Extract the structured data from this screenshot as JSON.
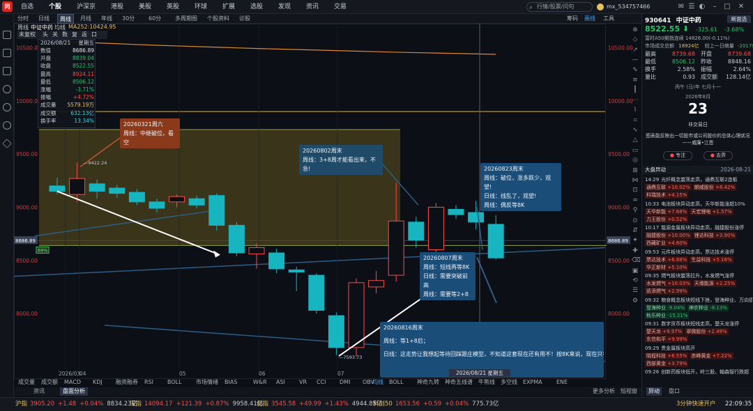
{
  "app": {
    "logo": "自选",
    "menus": [
      "自选",
      "个股",
      "沪深京",
      "港股",
      "美股",
      "英股",
      "环球",
      "扩展",
      "选股",
      "发现",
      "资讯",
      "交易"
    ],
    "active_menu": "个股",
    "search_placeholder": "行情/股票/问句",
    "user": "mx_534757466"
  },
  "tabbar": {
    "tabs": [
      "分时",
      "日线",
      "周线",
      "月线",
      "年线",
      "30分",
      "60分",
      "多周期图",
      "个股资料",
      "诊股"
    ],
    "selected": "周线",
    "right_items": [
      "筹码",
      "画线",
      "工具"
    ]
  },
  "indicator_row": {
    "label1": "周线",
    "label2": "中证中药",
    "label3": "均线",
    "ma": "MA252:10424.95"
  },
  "toolbar2": [
    "未复权",
    "头",
    "关",
    "数",
    "复",
    "返",
    "口"
  ],
  "info_panel": {
    "date": "2026/08/21",
    "weekday": "星期五",
    "rows": [
      {
        "k": "数值",
        "v": "8686.89",
        "c": "white"
      },
      {
        "k": "开盘",
        "v": "8839.04",
        "c": "green"
      },
      {
        "k": "收盘",
        "v": "8522.55",
        "c": "green"
      },
      {
        "k": "最高",
        "v": "8924.11",
        "c": "red"
      },
      {
        "k": "最低",
        "v": "8506.12",
        "c": "green"
      },
      {
        "k": "涨幅",
        "v": "-3.71%",
        "c": "green"
      },
      {
        "k": "振幅",
        "v": "+4.72%",
        "c": "red"
      },
      {
        "k": "成交量",
        "v": "5579.19万",
        "c": "yellow"
      },
      {
        "k": "成交额",
        "v": "632.13亿",
        "c": "cyan"
      },
      {
        "k": "换手率",
        "v": "13.34%",
        "c": "cyan"
      }
    ]
  },
  "notes": {
    "n1_title": "20260321周六",
    "n1_body": "周线：中继破位，看空",
    "n2_title": "20260802周末",
    "n2_body": "周线：3+8周才能看出来，不急!",
    "n3_title": "20260823周末",
    "n3_l1": "周线：破位，涨多跌少，观望!",
    "n3_l2": "日线：线乱了，观望!",
    "n3_l3": "周线：偶反等8K",
    "n4_title": "20260807周末",
    "n4_l1": "周线：短线再等8K",
    "n4_l2": "日线：需要突破前高",
    "n4_l3": "周线：需要等2+8",
    "n5_title": "20260816周末",
    "n5_l1": "周线：等1+8后；",
    "n5_l2": "日线：这走势让我想起等待回踩跟庄模型，不知道这套现在还有用不！按8K来说，现在只有"
  },
  "chart_data": {
    "type": "candlestick",
    "title": "中证中药",
    "period": "周线",
    "y_ticks": [
      "10500.00",
      "10000.00",
      "9500.00",
      "9000.00",
      "8500.00",
      "8000.00"
    ],
    "ylim": [
      7450,
      10700
    ],
    "x_ticks": [
      "2026/03",
      "04",
      "05",
      "06",
      "07"
    ],
    "current_price_label": "8686.89",
    "cursor_date": "2026/08/21 星期五",
    "percent_label": "69%",
    "high_label": "9422.24",
    "low_label": "7593.73",
    "candles": [
      {
        "o": 9200,
        "c": 9150,
        "h": 9280,
        "l": 9120
      },
      {
        "o": 9120,
        "c": 9270,
        "h": 9422,
        "l": 9050
      },
      {
        "o": 9220,
        "c": 9150,
        "h": 9260,
        "l": 9080
      },
      {
        "o": 9180,
        "c": 9130,
        "h": 9210,
        "l": 9090
      },
      {
        "o": 9140,
        "c": 9050,
        "h": 9170,
        "l": 9020
      },
      {
        "o": 9050,
        "c": 8990,
        "h": 9080,
        "l": 8950
      },
      {
        "o": 9050,
        "c": 9100,
        "h": 9120,
        "l": 9000
      },
      {
        "o": 9080,
        "c": 9020,
        "h": 9110,
        "l": 8990
      },
      {
        "o": 9110,
        "c": 8830,
        "h": 9130,
        "l": 8780
      },
      {
        "o": 8830,
        "c": 8570,
        "h": 8860,
        "l": 8540
      },
      {
        "o": 8560,
        "c": 8620,
        "h": 8660,
        "l": 8420
      },
      {
        "o": 8570,
        "c": 8420,
        "h": 8610,
        "l": 8380
      },
      {
        "o": 8410,
        "c": 8390,
        "h": 8440,
        "l": 8210
      },
      {
        "o": 8360,
        "c": 8030,
        "h": 8380,
        "l": 8000
      },
      {
        "o": 7980,
        "c": 7680,
        "h": 8010,
        "l": 7610
      },
      {
        "o": 7680,
        "c": 8290,
        "h": 8330,
        "l": 7594
      },
      {
        "o": 8250,
        "c": 8310,
        "h": 8400,
        "l": 8190
      },
      {
        "o": 8360,
        "c": 8870,
        "h": 9230,
        "l": 8300
      },
      {
        "o": 8860,
        "c": 8690,
        "h": 8910,
        "l": 8620
      },
      {
        "o": 8600,
        "c": 9000,
        "h": 9040,
        "l": 8560
      },
      {
        "o": 8980,
        "c": 8930,
        "h": 9020,
        "l": 8890
      },
      {
        "o": 8950,
        "c": 8860,
        "h": 9060,
        "l": 8790
      },
      {
        "o": 8839,
        "c": 8523,
        "h": 8924,
        "l": 8506
      }
    ],
    "ma_line": [
      10560,
      10552,
      10545,
      10538,
      10530,
      10523,
      10517,
      10511,
      10505,
      10499,
      10493,
      10488,
      10483,
      10478,
      10473,
      10468,
      10463,
      10458,
      10454,
      10450,
      10446,
      10442,
      10438
    ],
    "zone": {
      "top": 9730,
      "bottom": 8640
    },
    "hline": 9900
  },
  "indicator_tabs": [
    "成交量",
    "成交额",
    "MACD",
    "KDJ",
    "融资融券",
    "RSI",
    "BOLL",
    "市场情绪",
    "BIAS",
    "W&R",
    "ASI",
    "VR",
    "CCI",
    "DMI",
    "OBV"
  ],
  "sub_tabs": [
    "均线",
    "BOLL",
    "神奇九转",
    "神奇五线谱",
    "牛熊线",
    "多空线",
    "EXPMA",
    "ENE"
  ],
  "sub_bar": [
    "资讯",
    "盘面分析"
  ],
  "sub_right": [
    "更多分析",
    "短视窗"
  ],
  "right_panel": {
    "code": "930641",
    "name": "中证中药",
    "buttons": [
      "断面选"
    ],
    "price": "8522.55",
    "change": "-325.61",
    "pct": "-3.68%",
    "line1": "富时A50期指连续  14826.00(-0.11%)",
    "line2a": "市场成交总额",
    "line2b": "18924亿",
    "line2c": "较上一日缩量",
    "line2d": "-2017亿",
    "quotes": [
      {
        "k": "最高",
        "v": "8739.68",
        "k2": "开盘",
        "v2": "8739.68"
      },
      {
        "k": "最低",
        "v": "8506.12",
        "k2": "昨收",
        "v2": "8848.16"
      },
      {
        "k": "换手",
        "v": "2.58%",
        "k2": "振幅",
        "v2": "2.64%"
      },
      {
        "k": "量比",
        "v": "0.93",
        "k2": "成交额",
        "v2": "128.14亿"
      }
    ],
    "cal_lunar": "丙午 (马)年 七月十一",
    "cal_month": "2026年8月",
    "cal_day": "23",
    "cal_status": "非交易日",
    "quote_text": "图表能反映出一切股市或公司股价的总体心理状况",
    "quote_author": "——威廉•江恩",
    "btn_a": "专注",
    "btn_b": "去弄",
    "news_header": "大盘异动",
    "news_date": "2026-08-21",
    "news": [
      {
        "t": "14:29",
        "h": "光纤概念震荡走高，通鼎互联2连板",
        "tags": [
          [
            "通鼎互联",
            "+10.02%"
          ],
          [
            "朗威股份",
            "+8.42%"
          ],
          [
            "科瑞技术",
            "+4.15%"
          ]
        ]
      },
      {
        "t": "10:33",
        "h": "电池板块异动走高，天华新能涨超10%",
        "tags": [
          [
            "天华新能",
            "+7.68%"
          ],
          [
            "天宏锂电",
            "+1.57%"
          ],
          [
            "力王股份",
            "+0.52%"
          ]
        ]
      },
      {
        "t": "10:17",
        "h": "能源金属板块异动走高，融捷股份涨停",
        "tags": [
          [
            "融捷股份",
            "+10.00%"
          ],
          [
            "锂达科技",
            "+3.90%"
          ],
          [
            "西藏矿业",
            "+4.60%"
          ]
        ]
      },
      {
        "t": "09:53",
        "h": "元件板块异动走高，票达技术涨停",
        "tags": [
          [
            "票达技术",
            "+6.88%"
          ],
          [
            "生益科技",
            "+5.16%"
          ],
          [
            "华正新材",
            "+5.10%"
          ]
        ]
      },
      {
        "t": "09:35",
        "h": "燃气板块震荡拉升，水发燃气涨停",
        "tags": [
          [
            "水发燃气",
            "+10.03%"
          ],
          [
            "天壕能源",
            "+2.25%"
          ],
          [
            "凯添燃气",
            "+2.99%"
          ]
        ]
      },
      {
        "t": "09:32",
        "h": "粮食概念板块短线下挫，登海种业、万向德农",
        "tags": [
          [
            "登海种业",
            "-9.04%"
          ],
          [
            "神农种业",
            "-8.13%"
          ],
          [
            "秋乐种业",
            "-15.21%"
          ]
        ]
      },
      {
        "t": "09:31",
        "h": "数字货币板块短线走高，楚天龙涨停",
        "tags": [
          [
            "楚天龙",
            "+9.97%"
          ],
          [
            "翠微股份",
            "+2.49%"
          ],
          [
            "东信和平",
            "+9.99%"
          ]
        ]
      },
      {
        "t": "09:29",
        "h": "贵金属板块高开",
        "tags": [
          [
            "晓程科技",
            "+8.55%"
          ],
          [
            "赤峰黄金",
            "+7.22%"
          ],
          [
            "西部黄金",
            "+3.79%"
          ]
        ]
      },
      {
        "t": "09:26",
        "h": "创新药板块低开，岭三股、翰森智行跌超",
        "tags": []
      }
    ],
    "right_tabs": [
      "异动",
      "盘口"
    ]
  },
  "status_bar": {
    "items": [
      {
        "name": "沪指",
        "price": "3905.20",
        "chg": "+1.48",
        "pct": "+0.04%",
        "amt": "8834.23亿"
      },
      {
        "name": "深指",
        "price": "14094.17",
        "chg": "+121.39",
        "pct": "+0.87%",
        "amt": "9958.41亿"
      },
      {
        "name": "创指",
        "price": "3545.58",
        "chg": "+49.99",
        "pct": "+1.43%",
        "amt": "4944.85亿"
      },
      {
        "name": "科创50",
        "price": "1653.56",
        "chg": "+0.59",
        "pct": "+0.04%",
        "amt": "775.73亿"
      }
    ],
    "right_text": "3分钟快速开户",
    "time": "22:09:35"
  },
  "colors": {
    "up": "#ff4b4b",
    "down": "#27c46a",
    "candle_down": "#16b5c0",
    "zone": "#6b5c20"
  }
}
